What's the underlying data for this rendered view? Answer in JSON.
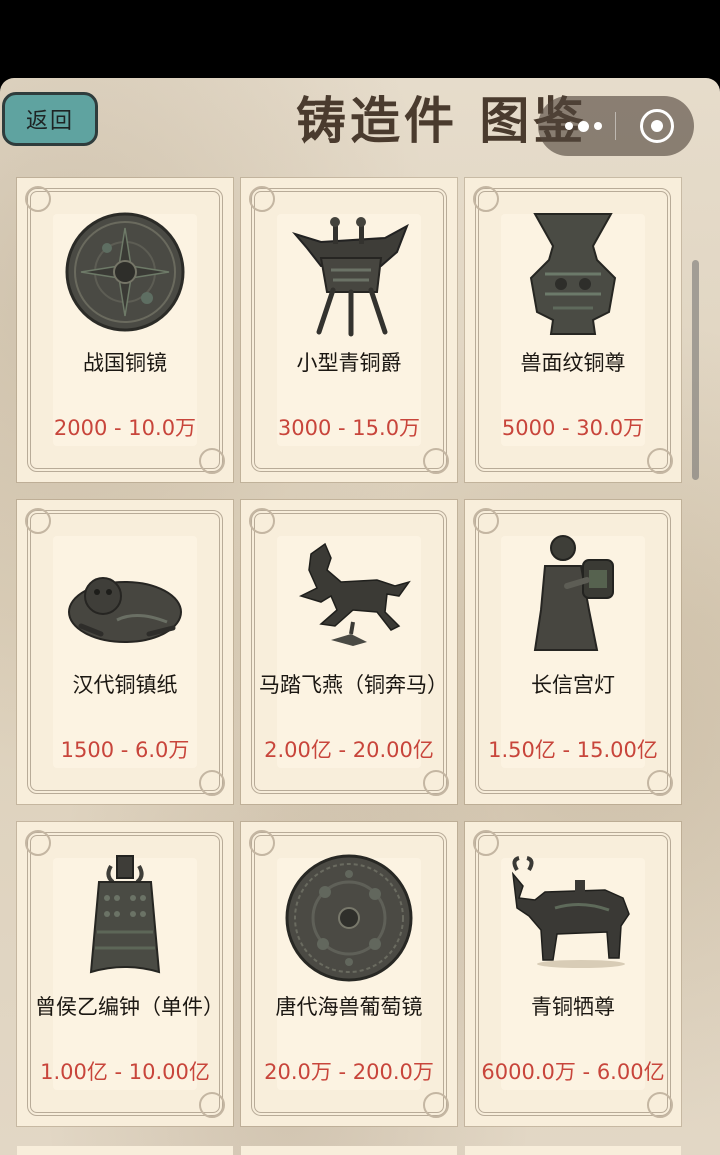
{
  "header": {
    "back_label": "返回",
    "title": "铸造件 图鉴"
  },
  "items": [
    {
      "name": "战国铜镜",
      "price": "2000 - 10.0万",
      "icon": "bronze-mirror-icon"
    },
    {
      "name": "小型青铜爵",
      "price": "3000 - 15.0万",
      "icon": "bronze-jue-vessel-icon"
    },
    {
      "name": "兽面纹铜尊",
      "price": "5000 - 30.0万",
      "icon": "bronze-zun-vase-icon"
    },
    {
      "name": "汉代铜镇纸",
      "price": "1500 - 6.0万",
      "icon": "bronze-paperweight-icon"
    },
    {
      "name": "马踏飞燕（铜奔马）",
      "price": "2.00亿 - 20.00亿",
      "icon": "galloping-horse-icon"
    },
    {
      "name": "长信宫灯",
      "price": "1.50亿 - 15.00亿",
      "icon": "palace-lamp-icon"
    },
    {
      "name": "曾侯乙编钟（单件）",
      "price": "1.00亿 - 10.00亿",
      "icon": "bronze-bell-icon"
    },
    {
      "name": "唐代海兽葡萄镜",
      "price": "20.0万 - 200.0万",
      "icon": "grape-mirror-icon"
    },
    {
      "name": "青铜牺尊",
      "price": "6000.0万 - 6.00亿",
      "icon": "ox-zun-icon"
    }
  ]
}
